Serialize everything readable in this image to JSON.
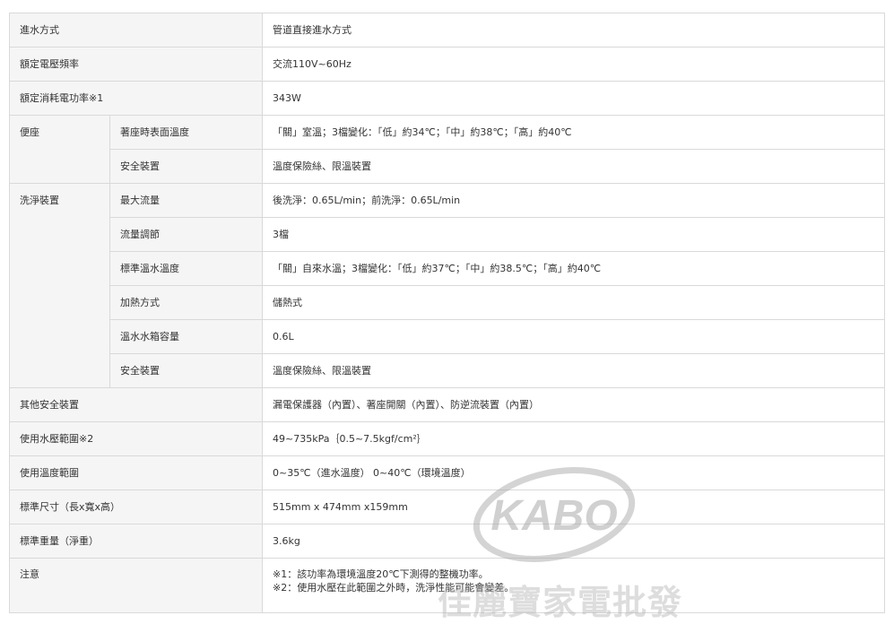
{
  "rows": {
    "water_inlet": {
      "label": "進水方式",
      "value": "管道直接進水方式"
    },
    "rated_voltage": {
      "label": "額定電壓頻率",
      "value": "交流110V~60Hz"
    },
    "rated_power": {
      "label": "額定消耗電功率※1",
      "value": "343W"
    },
    "seat": {
      "group": "便座",
      "items": [
        {
          "label": "著座時表面溫度",
          "value": "「關」室溫；3檔變化：「低」約34℃；「中」約38℃；「高」約40℃"
        },
        {
          "label": "安全裝置",
          "value": "溫度保險絲、限溫裝置"
        }
      ]
    },
    "washer": {
      "group": "洗淨裝置",
      "items": [
        {
          "label": "最大流量",
          "value": "後洗淨：0.65L/min；前洗淨：0.65L/min"
        },
        {
          "label": "流量調節",
          "value": "3檔"
        },
        {
          "label": "標準溫水溫度",
          "value": "「關」自來水溫；3檔變化：「低」約37℃；「中」約38.5℃；「高」約40℃"
        },
        {
          "label": "加熱方式",
          "value": "儲熱式"
        },
        {
          "label": "溫水水箱容量",
          "value": "0.6L"
        },
        {
          "label": "安全裝置",
          "value": "溫度保險絲、限溫裝置"
        }
      ]
    },
    "other_safety": {
      "label": "其他安全裝置",
      "value": "漏電保護器（內置）、著座開關（內置）、防逆流裝置（內置）"
    },
    "water_pressure": {
      "label": "使用水壓範圍※2",
      "value": "49~735kPa｛0.5~7.5kgf/cm²｝"
    },
    "temp_range": {
      "label": "使用溫度範圍",
      "value": "0~35℃（進水溫度） 0~40℃（環境溫度）"
    },
    "dimensions": {
      "label": "標準尺寸（長x寬x高）",
      "value": "515mm x 474mm x159mm"
    },
    "weight": {
      "label": "標準重量（淨重）",
      "value": "3.6kg"
    },
    "notes": {
      "label": "注意",
      "lines": [
        "※1：該功率為環境溫度20℃下測得的整機功率。",
        "※2：使用水壓在此範圍之外時，洗淨性能可能會變差。"
      ]
    }
  },
  "watermark": {
    "logo": "KABO",
    "text": "佳麗寶家電批發"
  }
}
